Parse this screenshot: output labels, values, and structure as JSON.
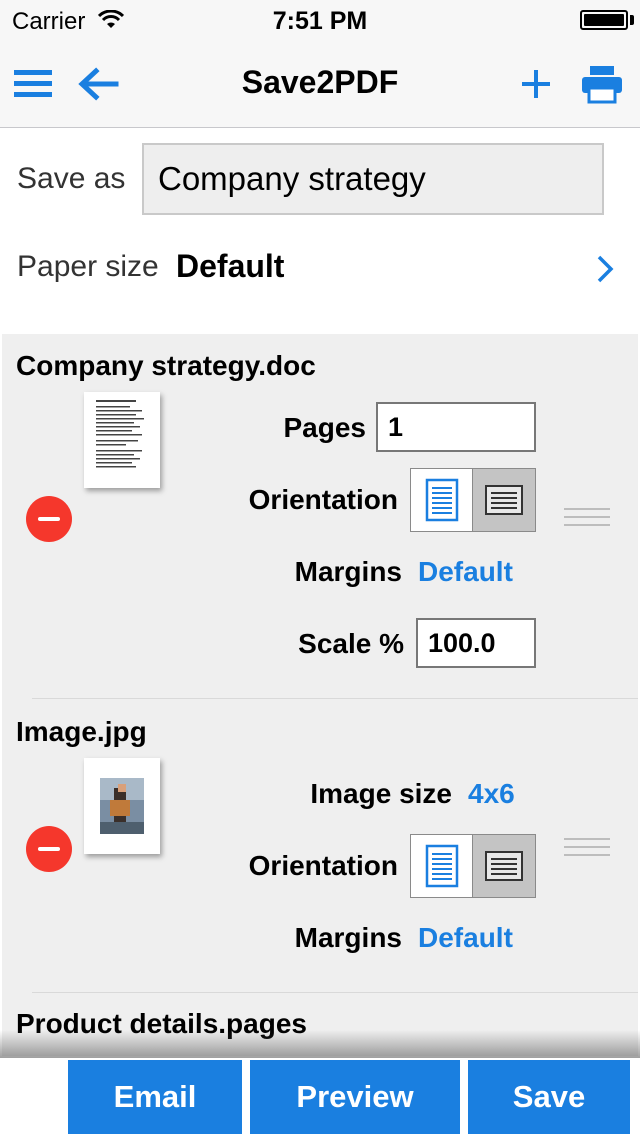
{
  "status": {
    "carrier": "Carrier",
    "time": "7:51 PM"
  },
  "nav": {
    "title": "Save2PDF"
  },
  "form": {
    "save_as_label": "Save as",
    "save_as_value": "Company strategy",
    "paper_label": "Paper size",
    "paper_value": "Default"
  },
  "items": [
    {
      "title": "Company strategy.doc",
      "pages_label": "Pages",
      "pages_value": "1",
      "orientation_label": "Orientation",
      "margins_label": "Margins",
      "margins_value": "Default",
      "scale_label": "Scale %",
      "scale_value": "100.0"
    },
    {
      "title": "Image.jpg",
      "image_size_label": "Image size",
      "image_size_value": "4x6",
      "orientation_label": "Orientation",
      "margins_label": "Margins",
      "margins_value": "Default"
    },
    {
      "title": "Product details.pages"
    }
  ],
  "toolbar": {
    "email": "Email",
    "preview": "Preview",
    "save": "Save"
  },
  "colors": {
    "accent": "#1a7fe0",
    "remove": "#f5372c",
    "list_bg": "#efefef"
  }
}
